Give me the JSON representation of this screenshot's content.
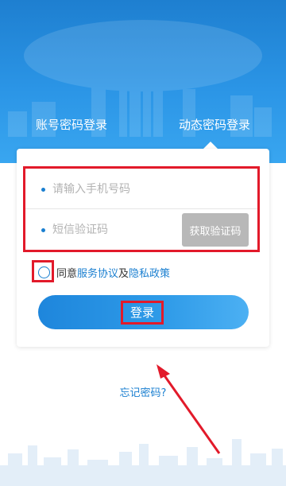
{
  "tabs": {
    "account_password": "账号密码登录",
    "dynamic_password": "动态密码登录"
  },
  "form": {
    "phone_placeholder": "请输入手机号码",
    "code_placeholder": "短信验证码",
    "get_code_label": "获取验证码"
  },
  "agreement": {
    "prefix": "同意",
    "service_link": "服务协议",
    "and": "及",
    "privacy_link": "隐私政策"
  },
  "login_label": "登录",
  "forgot_label": "忘记密码?",
  "colors": {
    "accent": "#1a7fd0",
    "annotation_red": "#e21a2a"
  }
}
